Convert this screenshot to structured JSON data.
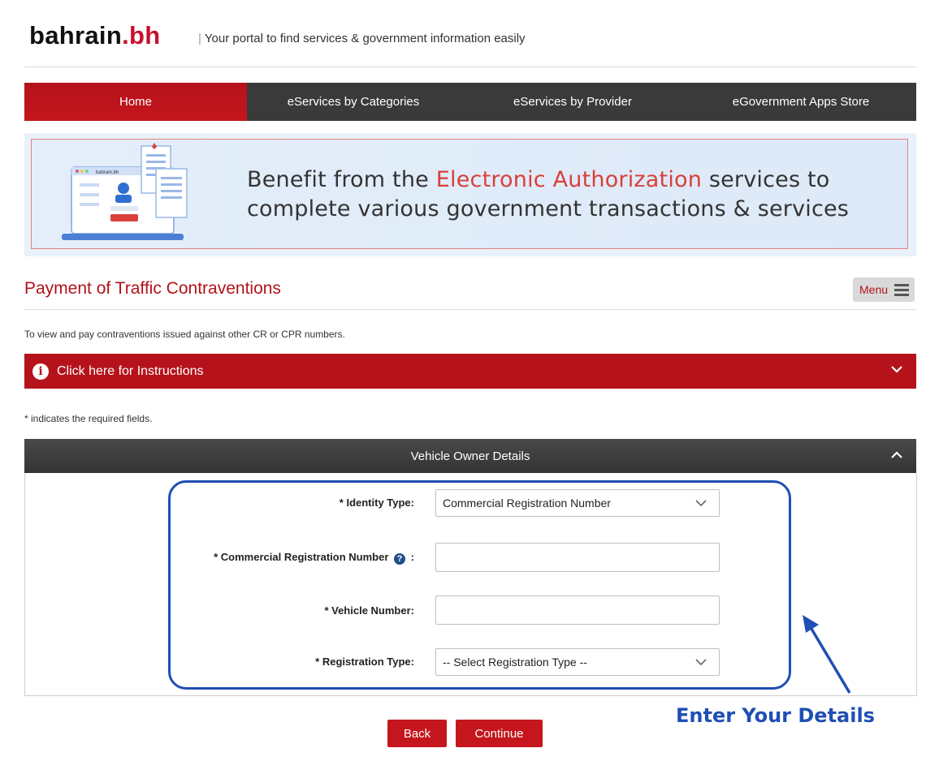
{
  "header": {
    "brand_main": "bahrain",
    "brand_dot": ".bh",
    "tagline_sep": "|",
    "tagline": "Your portal to find services & government information easily"
  },
  "nav": {
    "items": [
      {
        "label": "Home"
      },
      {
        "label": "eServices by Categories"
      },
      {
        "label": "eServices by Provider"
      },
      {
        "label": "eGovernment Apps Store"
      }
    ]
  },
  "banner": {
    "line1_prefix": "Benefit from the ",
    "line1_highlight": "Electronic Authorization",
    "line1_suffix": " services to",
    "line2": "complete various government transactions & services",
    "illustration_brand": "bahrain.bh"
  },
  "page": {
    "title": "Payment of Traffic Contraventions",
    "menu_label": "Menu",
    "description": "To view and pay contraventions issued against other CR or CPR numbers.",
    "instructions_label": "Click here for Instructions",
    "required_note": "* indicates the required fields."
  },
  "panel": {
    "title": "Vehicle Owner Details",
    "fields": {
      "identity_type": {
        "label": "* Identity Type:",
        "value": "Commercial Registration Number"
      },
      "cr_number": {
        "label": "* Commercial Registration Number",
        "label_suffix": ":",
        "value": ""
      },
      "vehicle_number": {
        "label": "* Vehicle Number:",
        "value": ""
      },
      "registration_type": {
        "label": "* Registration Type:",
        "value": "-- Select Registration Type --"
      }
    }
  },
  "actions": {
    "back_label": "Back",
    "continue_label": "Continue"
  },
  "annotation": {
    "callout": "Enter Your Details"
  },
  "colors": {
    "brand_red": "#c4161c",
    "nav_dark": "#3a3a3a",
    "annotation_blue": "#1f4fb4"
  }
}
